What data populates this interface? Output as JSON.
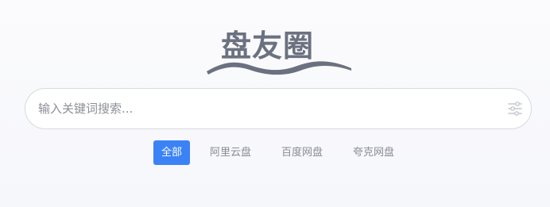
{
  "logo": {
    "text": "盘友圈",
    "color": "#6b7180"
  },
  "search": {
    "placeholder": "输入关键词搜索..."
  },
  "icons": {
    "filter": "sliders-icon"
  },
  "tabs": [
    {
      "label": "全部",
      "active": true
    },
    {
      "label": "阿里云盘",
      "active": false
    },
    {
      "label": "百度网盘",
      "active": false
    },
    {
      "label": "夸克网盘",
      "active": false
    }
  ],
  "colors": {
    "accent": "#3b82f6",
    "tab_text": "#888b92",
    "border": "#d6d9df"
  }
}
